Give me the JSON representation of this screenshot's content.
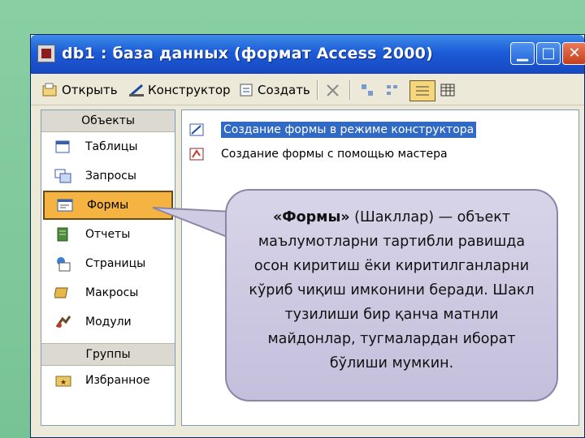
{
  "window": {
    "title": "db1 : база данных (формат Access 2000)"
  },
  "toolbar": {
    "open": "Открыть",
    "designer": "Конструктор",
    "create": "Создать"
  },
  "objects_panel": {
    "header": "Объекты",
    "items": [
      {
        "label": "Таблицы",
        "icon": "table-icon"
      },
      {
        "label": "Запросы",
        "icon": "query-icon"
      },
      {
        "label": "Формы",
        "icon": "form-icon"
      },
      {
        "label": "Отчеты",
        "icon": "report-icon"
      },
      {
        "label": "Страницы",
        "icon": "page-icon"
      },
      {
        "label": "Макросы",
        "icon": "macro-icon"
      },
      {
        "label": "Модули",
        "icon": "module-icon"
      }
    ],
    "groups_header": "Группы",
    "groups": [
      {
        "label": "Избранное",
        "icon": "favorites-icon"
      }
    ]
  },
  "list": {
    "items": [
      {
        "label": "Создание формы в режиме конструктора"
      },
      {
        "label": "Создание формы с помощью мастера"
      }
    ]
  },
  "callout": {
    "bold": "«Формы»",
    "text": " (Шакллар) — объект маълумотларни тартибли равишда осон киритиш ёки киритилганларни кўриб чиқиш имконини беради. Шакл тузилиши бир қанча матнли майдонлар, тугмалардан иборат бўлиши мумкин."
  },
  "colors": {
    "titlebar": "#1c5bd6",
    "selection": "#f5b342",
    "highlight": "#316ac5",
    "callout": "#c4bfdc"
  }
}
